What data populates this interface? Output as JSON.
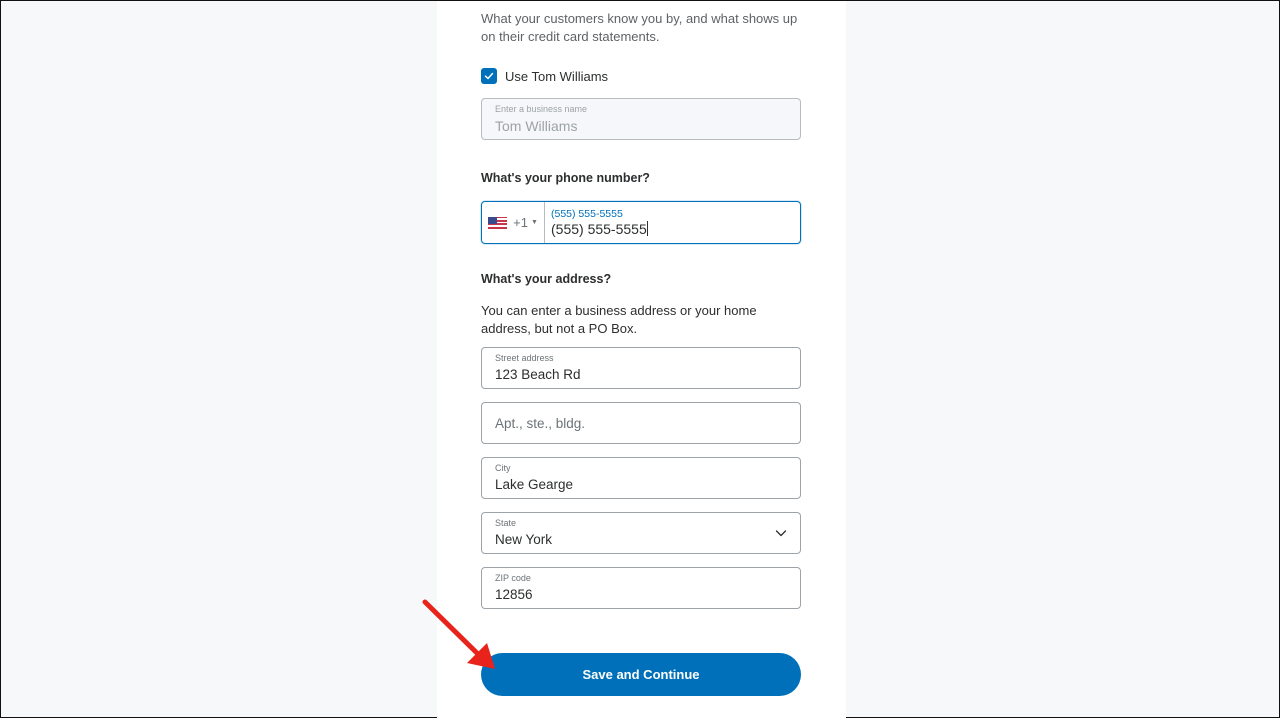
{
  "business_name": {
    "description": "What your customers know you by, and what shows up on their credit card statements.",
    "use_name_checkbox": {
      "label": "Use Tom Williams",
      "checked": true
    },
    "field": {
      "label": "Enter a business name",
      "value": "Tom Williams",
      "disabled": true
    }
  },
  "phone": {
    "heading": "What's your phone number?",
    "country_flag": "us-flag-icon",
    "country_code": "+1",
    "field_label": "(555) 555-5555",
    "value": "(555) 555-5555"
  },
  "address": {
    "heading": "What's your address?",
    "description": "You can enter a business address or your home address, but not a PO Box.",
    "street": {
      "label": "Street address",
      "value": "123 Beach Rd"
    },
    "apt": {
      "placeholder": "Apt., ste., bldg.",
      "value": ""
    },
    "city": {
      "label": "City",
      "value": "Lake Gearge"
    },
    "state": {
      "label": "State",
      "value": "New York"
    },
    "zip": {
      "label": "ZIP code",
      "value": "12856"
    }
  },
  "actions": {
    "save_label": "Save and Continue"
  },
  "annotation": {
    "arrow_color": "#e8231b",
    "target": "save-and-continue-button"
  },
  "colors": {
    "primary": "#0070ba",
    "background": "#f7f8fa",
    "card": "#ffffff"
  }
}
